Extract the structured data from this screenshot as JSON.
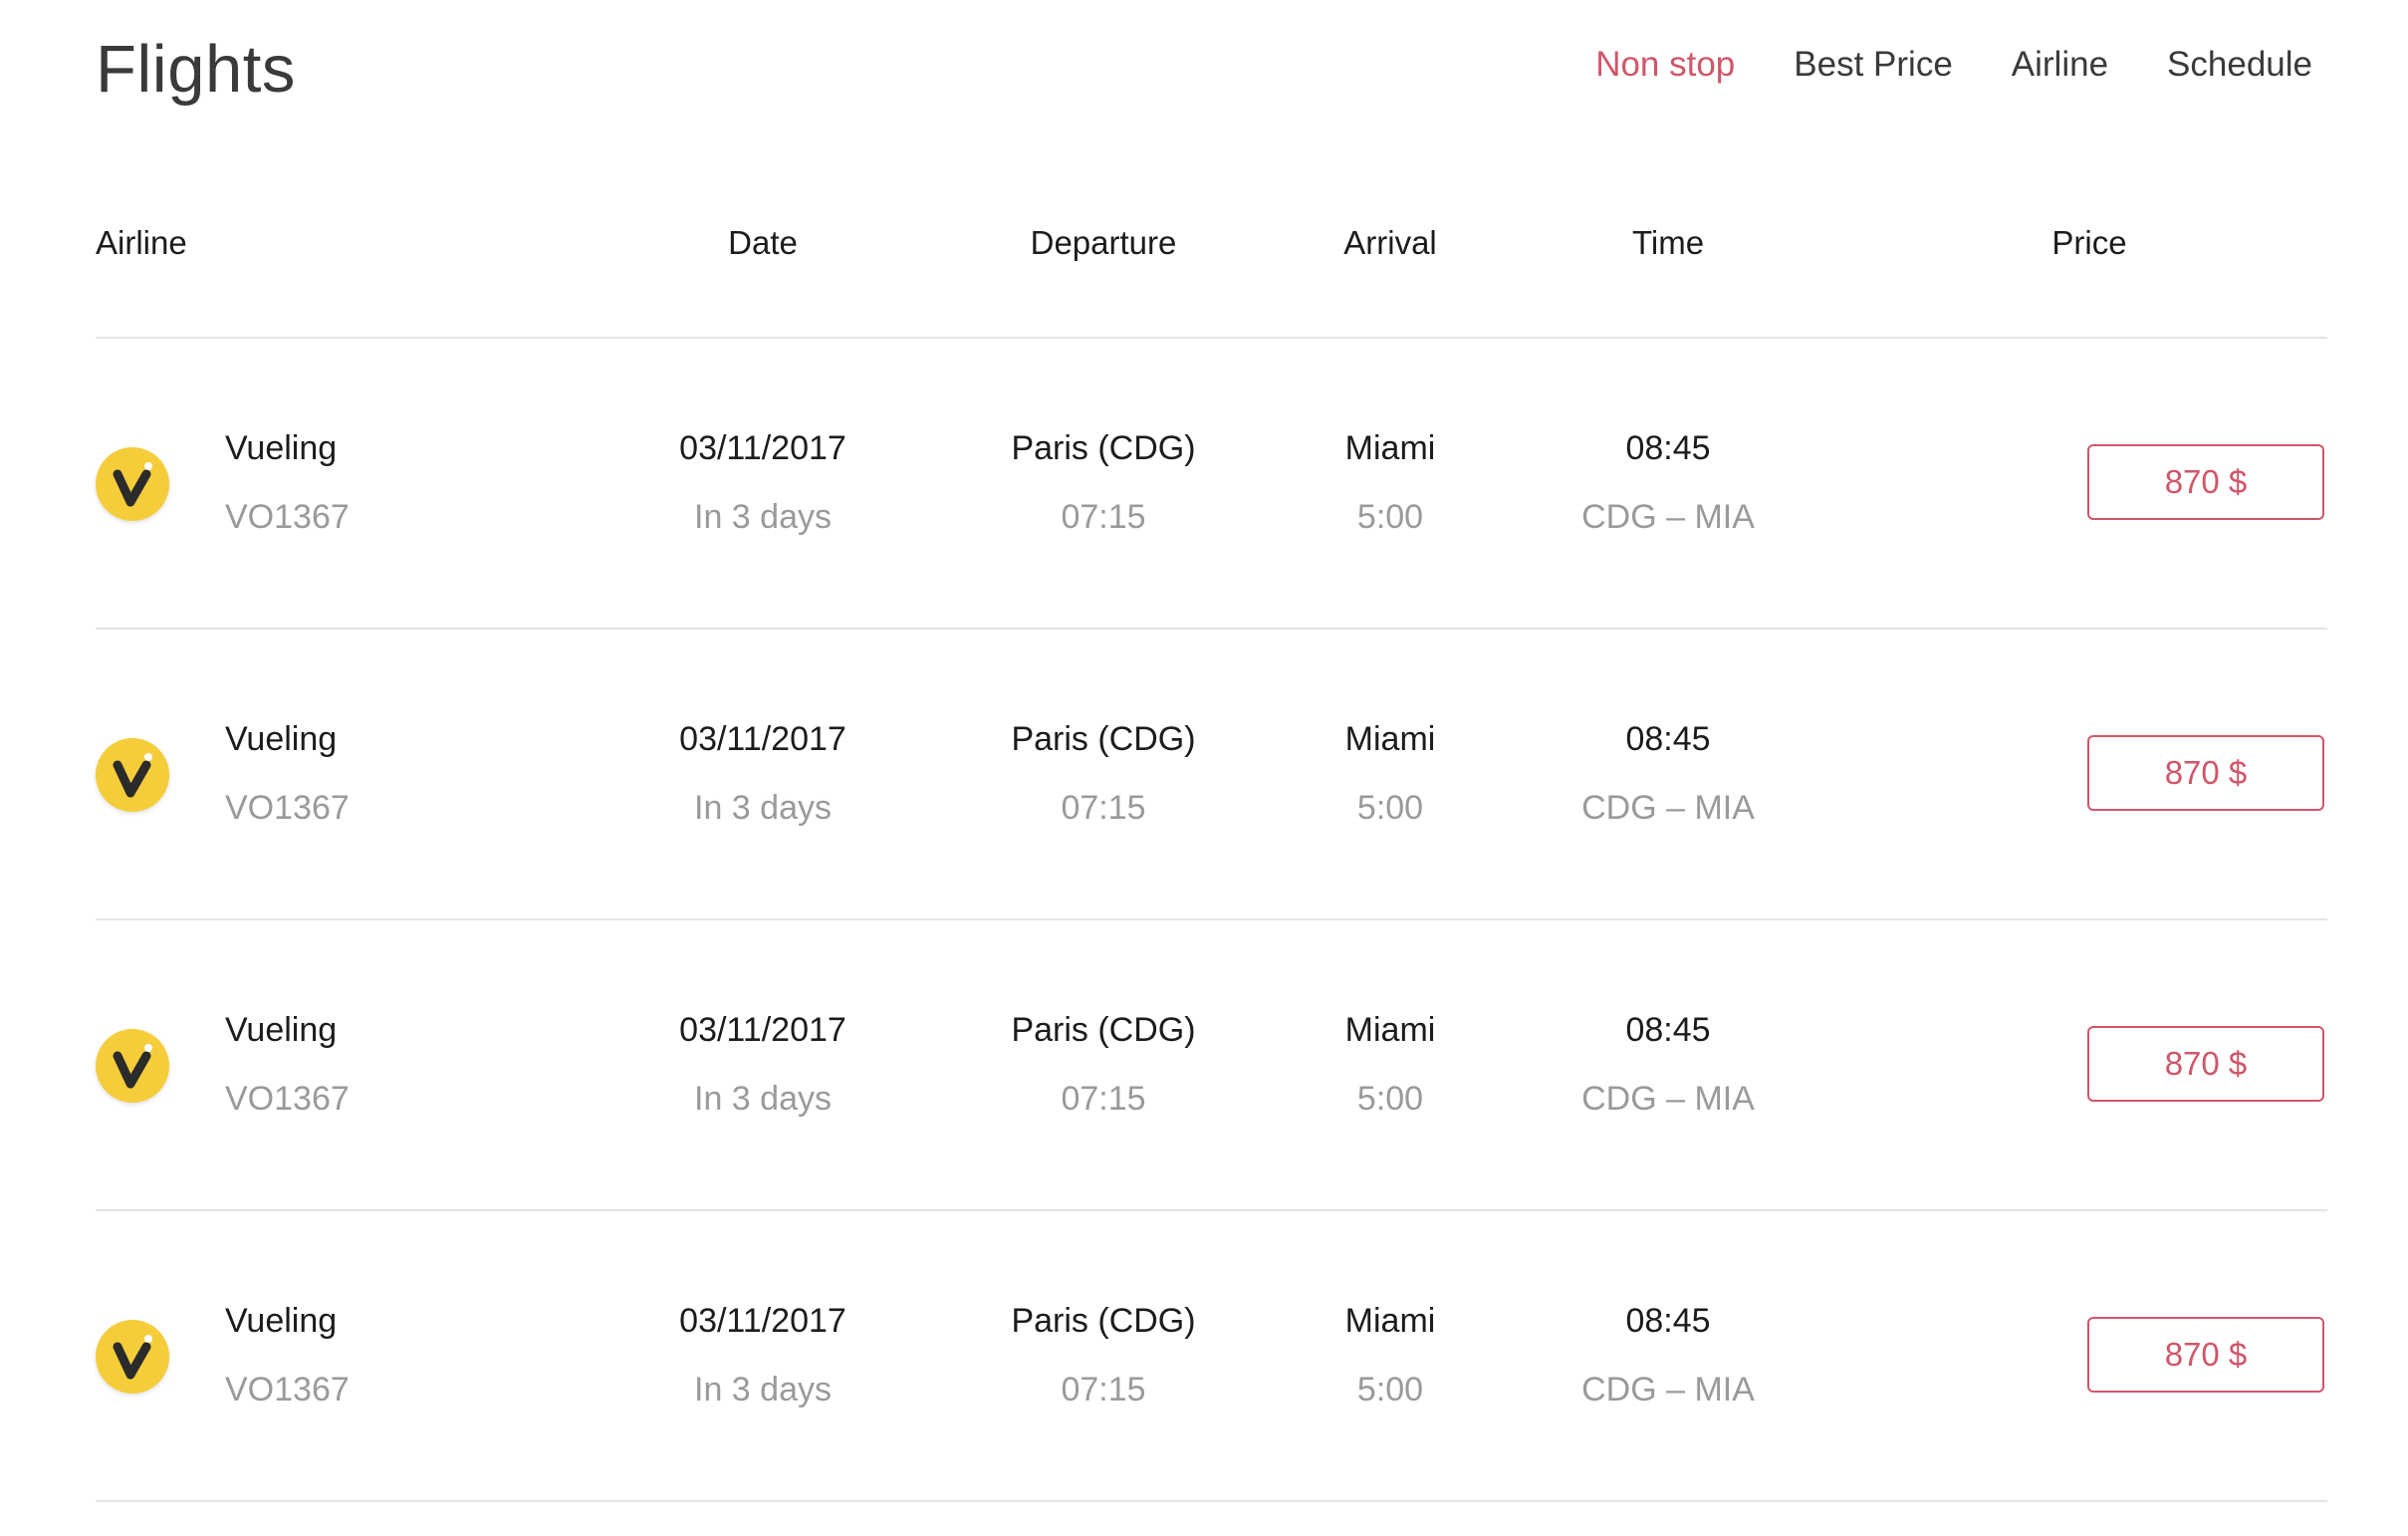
{
  "page": {
    "title": "Flights"
  },
  "filters": [
    {
      "label": "Non stop",
      "active": true
    },
    {
      "label": "Best Price",
      "active": false
    },
    {
      "label": "Airline",
      "active": false
    },
    {
      "label": "Schedule",
      "active": false
    }
  ],
  "table": {
    "headers": {
      "airline": "Airline",
      "date": "Date",
      "departure": "Departure",
      "arrival": "Arrival",
      "time": "Time",
      "price": "Price"
    },
    "rows": [
      {
        "airline": "Vueling",
        "flight": "VO1367",
        "date": "03/11/2017",
        "relative": "In 3 days",
        "departure_city": "Paris (CDG)",
        "departure_time": "07:15",
        "arrival_city": "Miami",
        "arrival_duration": "5:00",
        "time": "08:45",
        "route": "CDG – MIA",
        "price": "870 $"
      },
      {
        "airline": "Vueling",
        "flight": "VO1367",
        "date": "03/11/2017",
        "relative": "In 3 days",
        "departure_city": "Paris (CDG)",
        "departure_time": "07:15",
        "arrival_city": "Miami",
        "arrival_duration": "5:00",
        "time": "08:45",
        "route": "CDG – MIA",
        "price": "870 $"
      },
      {
        "airline": "Vueling",
        "flight": "VO1367",
        "date": "03/11/2017",
        "relative": "In 3 days",
        "departure_city": "Paris (CDG)",
        "departure_time": "07:15",
        "arrival_city": "Miami",
        "arrival_duration": "5:00",
        "time": "08:45",
        "route": "CDG – MIA",
        "price": "870 $"
      },
      {
        "airline": "Vueling",
        "flight": "VO1367",
        "date": "03/11/2017",
        "relative": "In 3 days",
        "departure_city": "Paris (CDG)",
        "departure_time": "07:15",
        "arrival_city": "Miami",
        "arrival_duration": "5:00",
        "time": "08:45",
        "route": "CDG – MIA",
        "price": "870 $"
      }
    ]
  },
  "colors": {
    "accent": "#d0566a",
    "logo_yellow": "#f5cd3a",
    "muted_text": "#9a9a9a",
    "divider": "#e4e4e4"
  },
  "icons": {
    "airline_logo": "vueling-logo-icon"
  }
}
